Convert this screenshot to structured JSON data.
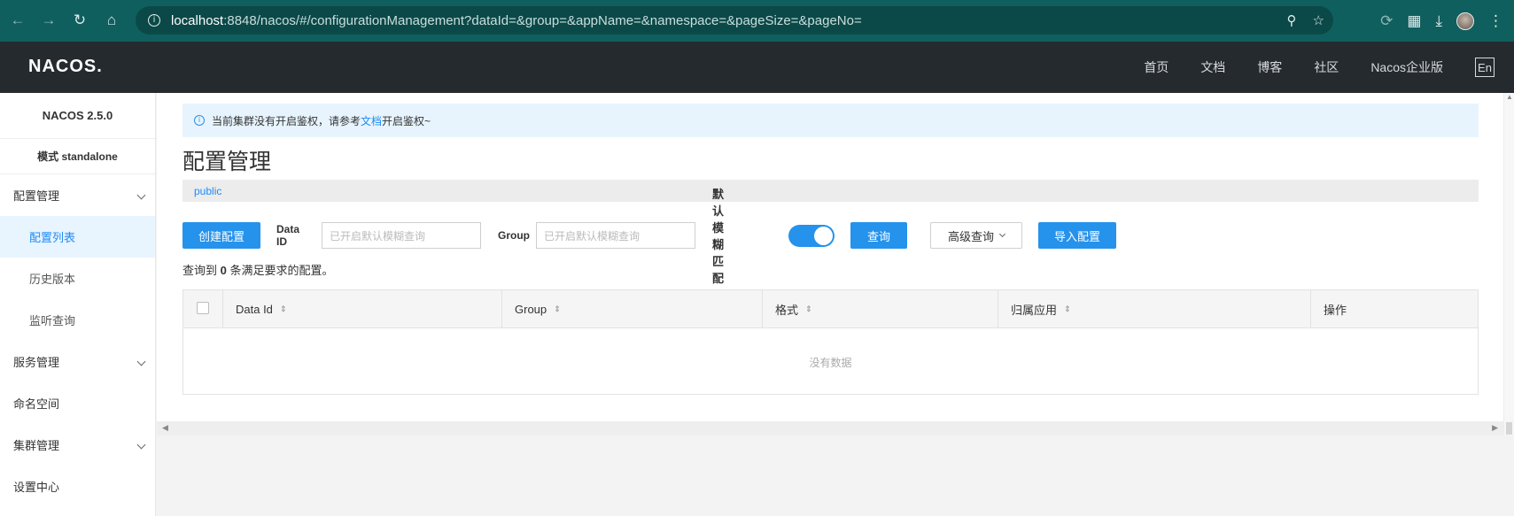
{
  "browser": {
    "url_host": "localhost",
    "url_rest": ":8848/nacos/#/configurationManagement?dataId=&group=&appName=&namespace=&pageSize=&pageNo=",
    "icons": [
      "back-icon",
      "forward-icon",
      "reload-icon",
      "home-icon",
      "site-info-icon",
      "zoom-icon",
      "star-icon",
      "sync-icon",
      "extensions-icon",
      "download-icon",
      "profile-avatar",
      "menu-dots-icon"
    ]
  },
  "header": {
    "logo": "NACOS.",
    "nav": [
      "首页",
      "文档",
      "博客",
      "社区",
      "Nacos企业版"
    ],
    "lang": "En"
  },
  "sidebar": {
    "title": "NACOS 2.5.0",
    "mode": "模式 standalone",
    "items": [
      {
        "label": "配置管理",
        "type": "group"
      },
      {
        "label": "配置列表",
        "type": "sub",
        "active": true
      },
      {
        "label": "历史版本",
        "type": "sub"
      },
      {
        "label": "监听查询",
        "type": "sub"
      },
      {
        "label": "服务管理",
        "type": "group"
      },
      {
        "label": "命名空间",
        "type": "item"
      },
      {
        "label": "集群管理",
        "type": "group"
      },
      {
        "label": "设置中心",
        "type": "item"
      }
    ]
  },
  "alert": {
    "text_before": "当前集群没有开启鉴权，请参考",
    "link": "文档",
    "text_after": "开启鉴权~"
  },
  "page_title": "配置管理",
  "namespace": "public",
  "filters": {
    "create_label": "创建配置",
    "dataid_label": "Data ID",
    "dataid_placeholder": "已开启默认模糊查询",
    "group_label": "Group",
    "group_placeholder": "已开启默认模糊查询",
    "fuzzy_label": "默认模糊匹配",
    "fuzzy_on": true,
    "query_label": "查询",
    "advanced_label": "高级查询",
    "import_label": "导入配置"
  },
  "result": {
    "prefix": "查询到",
    "count": "0",
    "suffix": "条满足要求的配置。"
  },
  "table": {
    "columns": [
      "Data Id",
      "Group",
      "格式",
      "归属应用",
      "操作"
    ],
    "empty_text": "没有数据"
  },
  "colors": {
    "primary": "#2592ec",
    "header_bg": "#252a2f",
    "browser_bg": "#0f5f5e"
  }
}
